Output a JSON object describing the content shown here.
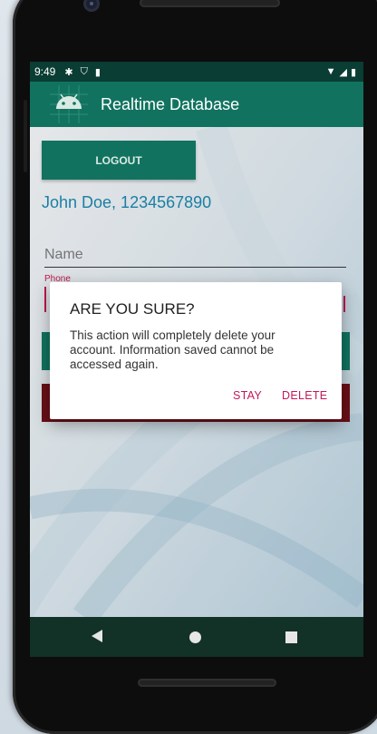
{
  "status_bar": {
    "time": "9:49",
    "left_icons": [
      "settings-icon",
      "shield-icon",
      "sd-card-icon"
    ],
    "right_icons": [
      "wifi-icon",
      "signal-icon",
      "battery-icon"
    ]
  },
  "app_bar": {
    "title": "Realtime Database"
  },
  "main": {
    "logout_label": "LOGOUT",
    "user_info": "John Doe, 1234567890",
    "name_placeholder": "Name",
    "phone_label": "Phone"
  },
  "dialog": {
    "title": "ARE YOU SURE?",
    "message": "This action will completely delete your account. Information saved cannot be accessed again.",
    "stay_label": "STAY",
    "delete_label": "DELETE"
  },
  "nav_bar": {
    "buttons": [
      "back-icon",
      "home-icon",
      "recents-icon"
    ]
  },
  "colors": {
    "primary": "#11735f",
    "status_bar": "#0a3d33",
    "accent": "#c2185b",
    "user_text": "#1a7fa3",
    "danger": "#6a0f17"
  }
}
